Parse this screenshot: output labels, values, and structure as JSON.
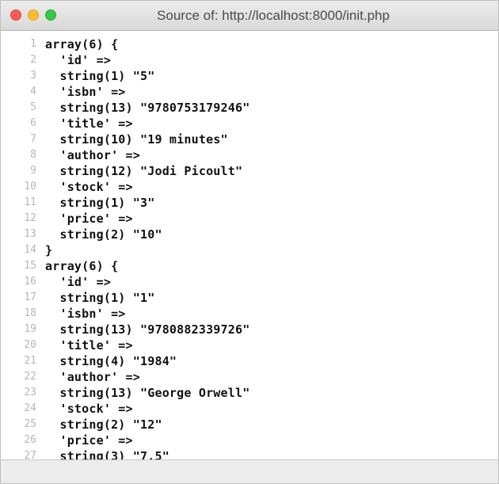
{
  "window": {
    "title": "Source of: http://localhost:8000/init.php",
    "traffic_lights": {
      "close": "#fc5b57",
      "minimize": "#fdbc2e",
      "zoom": "#34c84a"
    }
  },
  "source": {
    "lines": [
      {
        "number": "1",
        "text": "array(6) {"
      },
      {
        "number": "2",
        "text": "  'id' =>"
      },
      {
        "number": "3",
        "text": "  string(1) \"5\""
      },
      {
        "number": "4",
        "text": "  'isbn' =>"
      },
      {
        "number": "5",
        "text": "  string(13) \"9780753179246\""
      },
      {
        "number": "6",
        "text": "  'title' =>"
      },
      {
        "number": "7",
        "text": "  string(10) \"19 minutes\""
      },
      {
        "number": "8",
        "text": "  'author' =>"
      },
      {
        "number": "9",
        "text": "  string(12) \"Jodi Picoult\""
      },
      {
        "number": "10",
        "text": "  'stock' =>"
      },
      {
        "number": "11",
        "text": "  string(1) \"3\""
      },
      {
        "number": "12",
        "text": "  'price' =>"
      },
      {
        "number": "13",
        "text": "  string(2) \"10\""
      },
      {
        "number": "14",
        "text": "}"
      },
      {
        "number": "15",
        "text": "array(6) {"
      },
      {
        "number": "16",
        "text": "  'id' =>"
      },
      {
        "number": "17",
        "text": "  string(1) \"1\""
      },
      {
        "number": "18",
        "text": "  'isbn' =>"
      },
      {
        "number": "19",
        "text": "  string(13) \"9780882339726\""
      },
      {
        "number": "20",
        "text": "  'title' =>"
      },
      {
        "number": "21",
        "text": "  string(4) \"1984\""
      },
      {
        "number": "22",
        "text": "  'author' =>"
      },
      {
        "number": "23",
        "text": "  string(13) \"George Orwell\""
      },
      {
        "number": "24",
        "text": "  'stock' =>"
      },
      {
        "number": "25",
        "text": "  string(2) \"12\""
      },
      {
        "number": "26",
        "text": "  'price' =>"
      },
      {
        "number": "27",
        "text": "  string(3) \"7.5\""
      }
    ]
  }
}
